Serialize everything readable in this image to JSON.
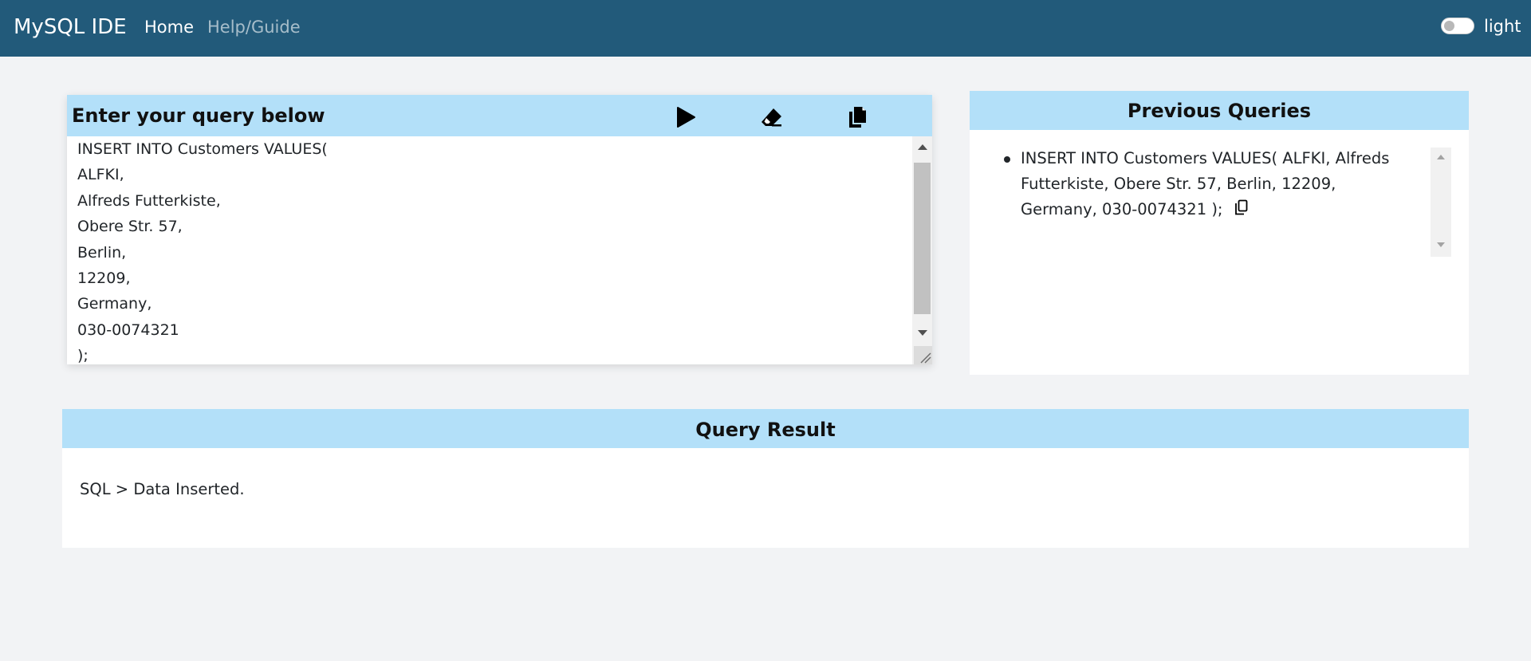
{
  "navbar": {
    "brand": "MySQL IDE",
    "links": [
      "Home",
      "Help/Guide"
    ],
    "theme_label": "light",
    "colors": {
      "background": "#225a7a",
      "active": "#ffffff",
      "inactive": "#a7bdca"
    }
  },
  "editor": {
    "title": "Enter your query below",
    "tools": [
      {
        "name": "run",
        "icon": "play-icon"
      },
      {
        "name": "clear",
        "icon": "eraser-icon"
      },
      {
        "name": "copy",
        "icon": "copy-icon"
      }
    ],
    "query": "INSERT INTO Customers VALUES(\nALFKI,\nAlfreds Futterkiste,\nObere Str. 57,\nBerlin,\n12209,\nGermany,\n030-0074321\n);"
  },
  "previous_queries": {
    "title": "Previous Queries",
    "items": [
      {
        "text": "INSERT INTO Customers VALUES( ALFKI, Alfreds Futterkiste, Obere Str. 57, Berlin, 12209, Germany, 030-0074321 );",
        "icon": "copy-icon"
      }
    ]
  },
  "result": {
    "title": "Query Result",
    "message": "SQL > Data Inserted."
  },
  "colors": {
    "panel_header": "#b3e0f9",
    "page_background": "#f2f3f5"
  }
}
